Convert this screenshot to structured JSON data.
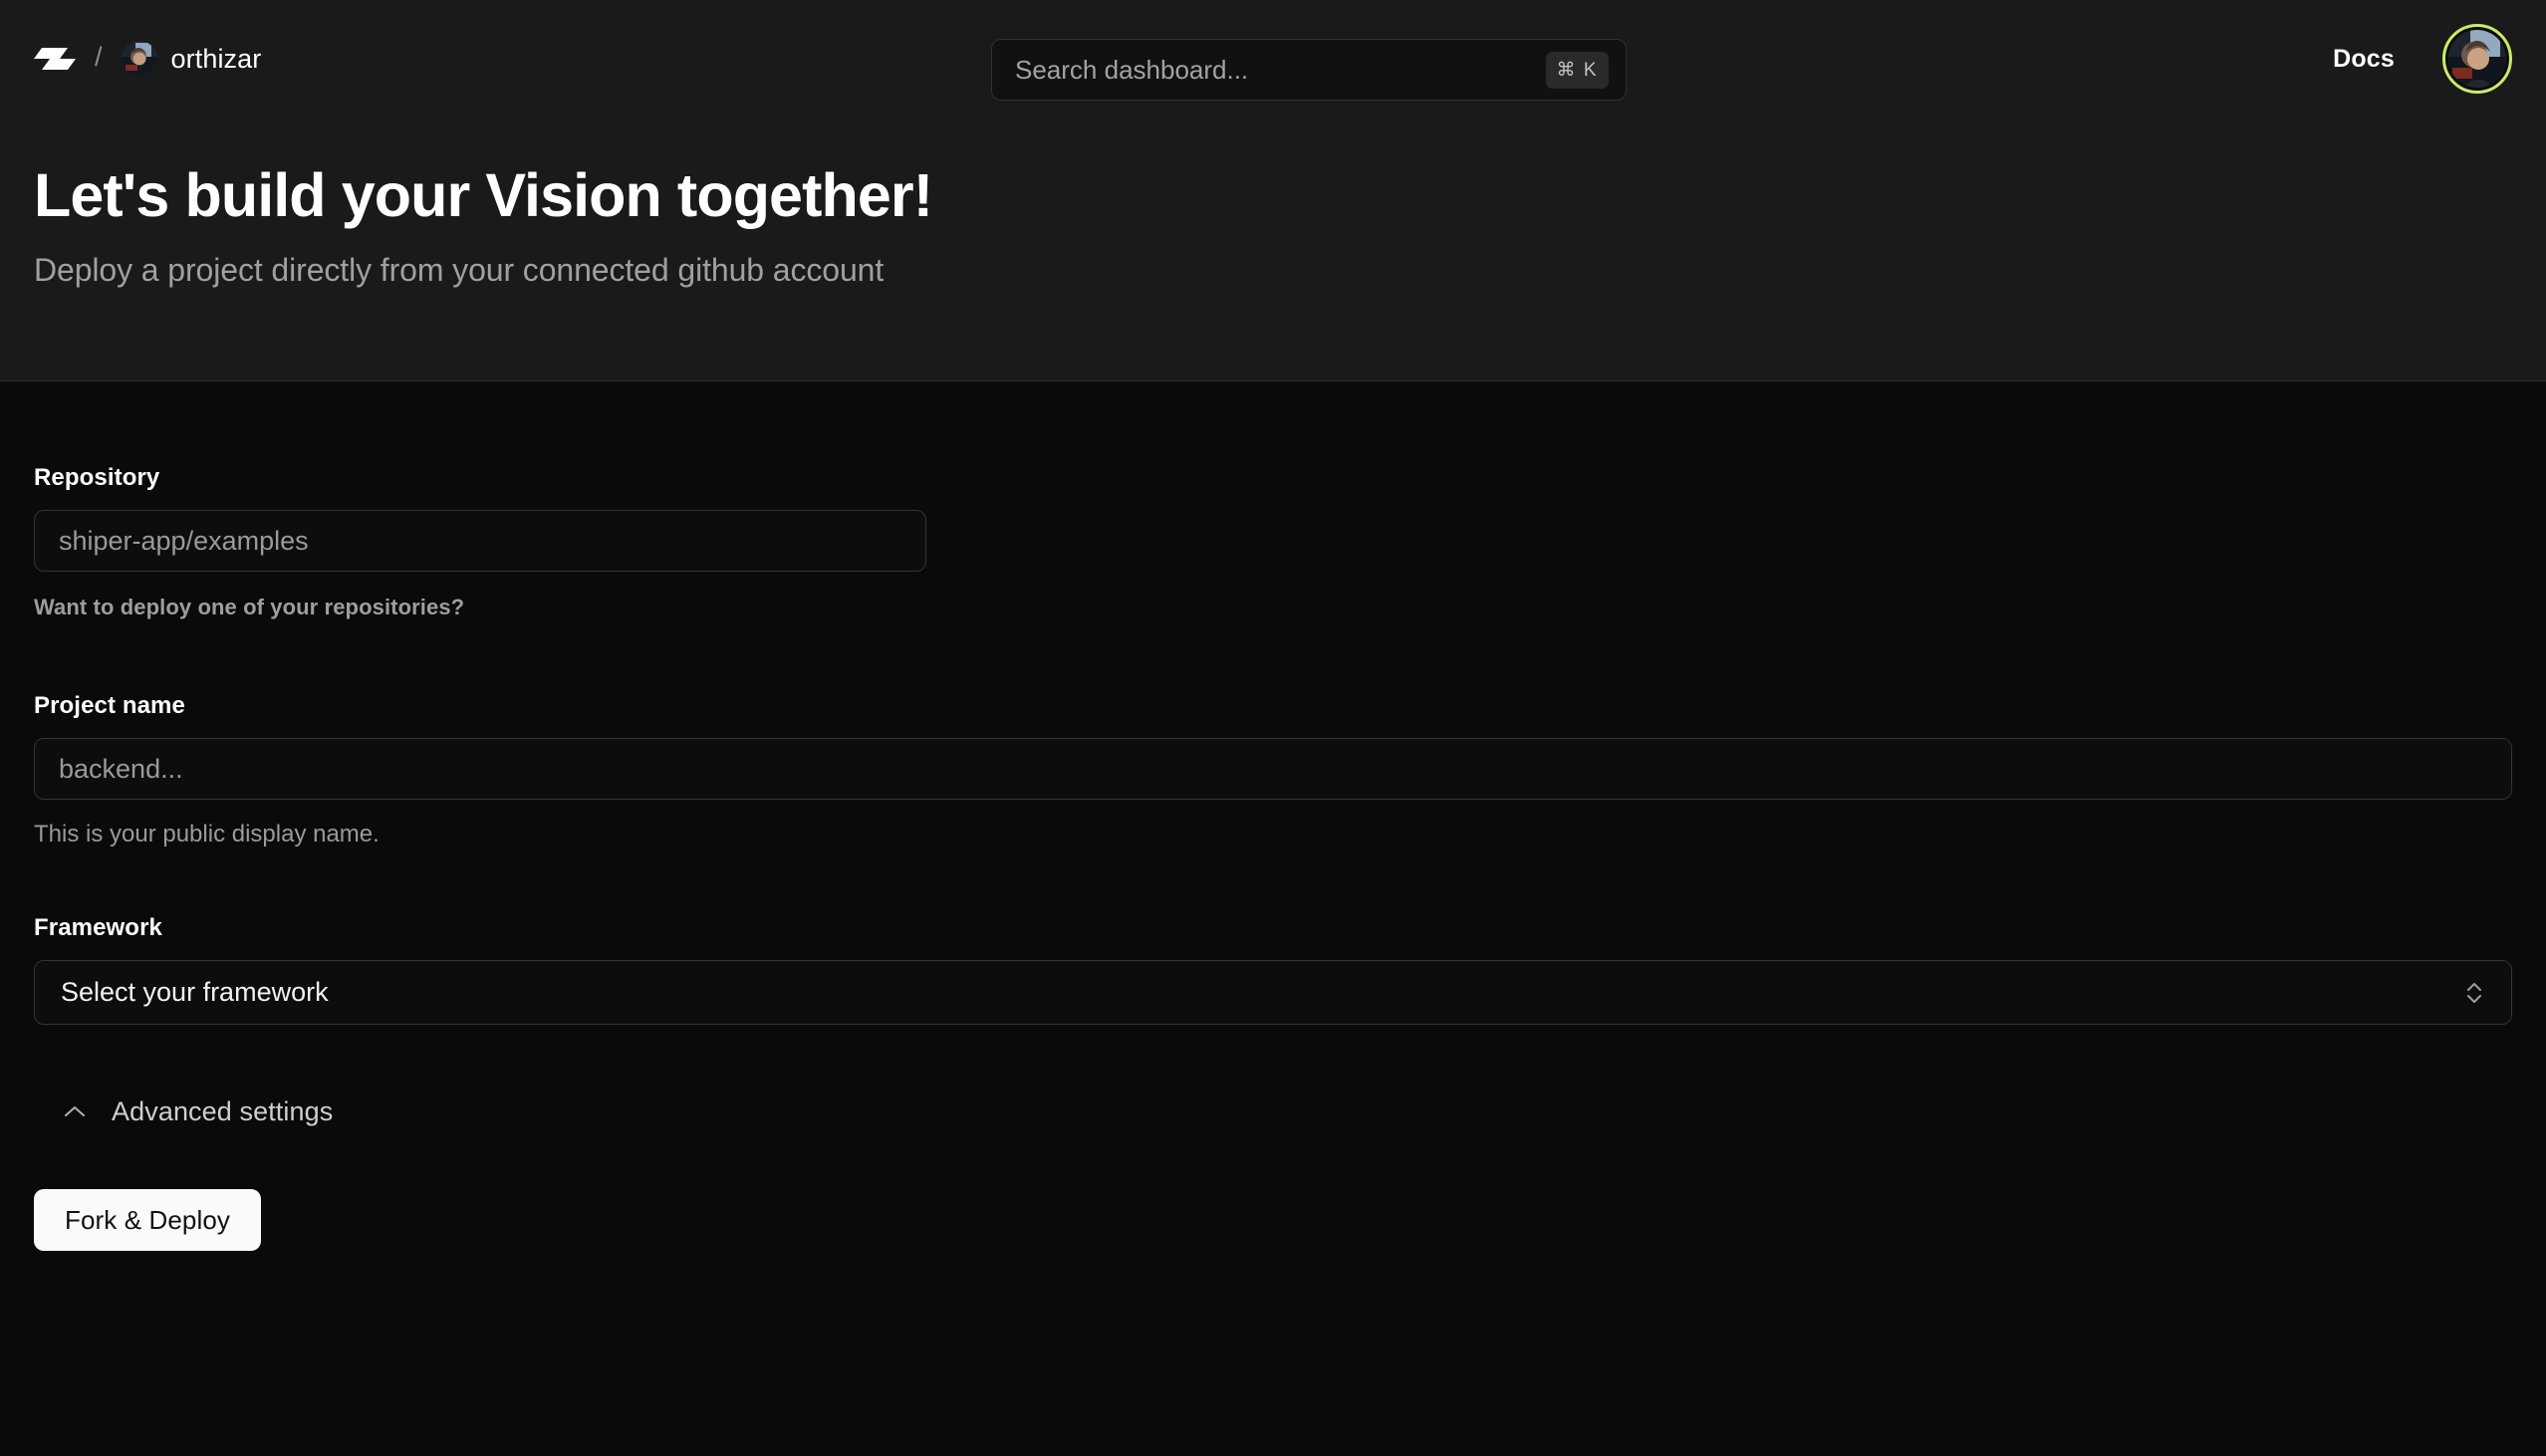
{
  "nav": {
    "logo_icon": "shiper-logo-icon",
    "breadcrumb_separator": "/",
    "org_name": "orthizar",
    "org_avatar_icon": "user-avatar-icon",
    "docs_label": "Docs",
    "profile_avatar_icon": "profile-avatar-icon",
    "profile_ring_color": "#cbe96d"
  },
  "search": {
    "placeholder": "Search dashboard...",
    "shortcut": "⌘ K"
  },
  "hero": {
    "title": "Let's build your Vision together!",
    "subtitle": "Deploy a project directly from your connected github account"
  },
  "form": {
    "repository": {
      "label": "Repository",
      "value": "shiper-app/examples",
      "helper": "Want to deploy one of your repositories?"
    },
    "project_name": {
      "label": "Project name",
      "placeholder": "backend...",
      "helper": "This is your public display name."
    },
    "framework": {
      "label": "Framework",
      "selected": "Select your framework",
      "chevron_icon": "chevron-up-down-icon"
    },
    "advanced": {
      "label": "Advanced settings",
      "chevron_icon": "chevron-up-icon"
    },
    "submit_label": "Fork & Deploy"
  },
  "theme": {
    "page_background": "#0a0a0a",
    "hero_background": "#1a1a1a",
    "accent": "#cbe96d",
    "button_background": "#fafafa"
  }
}
